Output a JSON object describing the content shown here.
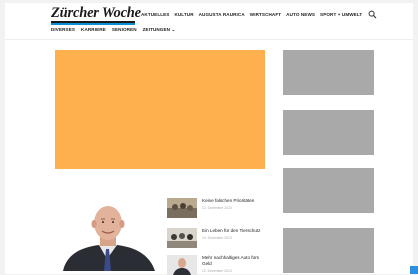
{
  "header": {
    "logo_text": "Zürcher Woche",
    "nav_main": [
      "AKTUELLES",
      "KULTUR",
      "AUGUSTA RAURICA",
      "WIRTSCHAFT",
      "AUTO NEWS",
      "SPORT + UMWELT"
    ],
    "nav_sub": [
      "DIVERSES",
      "KARRIERE",
      "SENIOREN",
      "ZEITUNGEN ⌄"
    ],
    "search_icon": "search-icon",
    "brand_color": "#0a8fd6"
  },
  "ads": {
    "main_color": "#fdb04d",
    "side_color": "#a9a9a9"
  },
  "articles": [
    {
      "title": "Keine falschen Prioritäten",
      "date": "12. Dezember 2023"
    },
    {
      "title": "Ein Leben für den Tierschutz",
      "date": "14. Dezember 2023"
    },
    {
      "title": "Mehr nachhaltiges Auto fürs Geld",
      "date": "12. Dezember 2023"
    }
  ]
}
